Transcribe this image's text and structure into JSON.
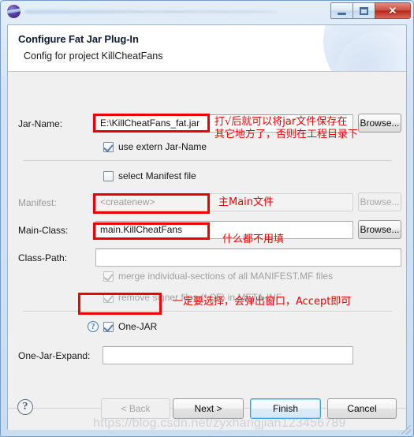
{
  "window": {
    "icon": "eclipse-sphere-icon",
    "minimize_label": "–",
    "maximize_label": "□",
    "close_label": "✕"
  },
  "header": {
    "title": "Configure Fat Jar Plug-In",
    "subtitle": "Config for project KillCheatFans"
  },
  "form": {
    "jar_name": {
      "label": "Jar-Name:",
      "value": "E:\\KillCheatFans_fat.jar",
      "browse_label": "Browse..."
    },
    "use_extern_jar_name": {
      "label": "use extern Jar-Name",
      "checked": true
    },
    "select_manifest_file": {
      "label": "select Manifest file",
      "checked": false
    },
    "manifest": {
      "label": "Manifest:",
      "value": "<createnew>",
      "browse_label": "Browse...",
      "disabled": true
    },
    "main_class": {
      "label": "Main-Class:",
      "value": "main.KillCheatFans",
      "browse_label": "Browse..."
    },
    "class_path": {
      "label": "Class-Path:",
      "value": ""
    },
    "merge_sections": {
      "label": "merge individual-sections of all MANIFEST.MF files",
      "checked": true,
      "disabled": true
    },
    "remove_signer": {
      "label": "remove signer files (*.SF) in META-INF",
      "checked": true,
      "disabled": true
    },
    "one_jar": {
      "label": "One-JAR",
      "checked": true,
      "help_icon": "?"
    },
    "one_jar_expand": {
      "label": "One-Jar-Expand:",
      "value": ""
    }
  },
  "annotations": [
    {
      "id": "jar-name-note",
      "line1": "打√后就可以将jar文件保存在",
      "line2": "其它地方了，否则在工程目录下"
    },
    {
      "id": "main-class-note",
      "text": "主Main文件"
    },
    {
      "id": "class-path-note",
      "text": "什么都不用填"
    },
    {
      "id": "one-jar-note",
      "text": "一定要选择，会弹出窗口，Accept即可"
    }
  ],
  "footer": {
    "help_label": "?",
    "back_label": "< Back",
    "next_label": "Next >",
    "finish_label": "Finish",
    "cancel_label": "Cancel"
  },
  "watermark": "https://blog.csdn.net/zyxhangjian123456789",
  "colors": {
    "annotation_red": "#ee0000",
    "default_button_border": "#3c9fd8",
    "titlebar_close": "#b6281b"
  }
}
